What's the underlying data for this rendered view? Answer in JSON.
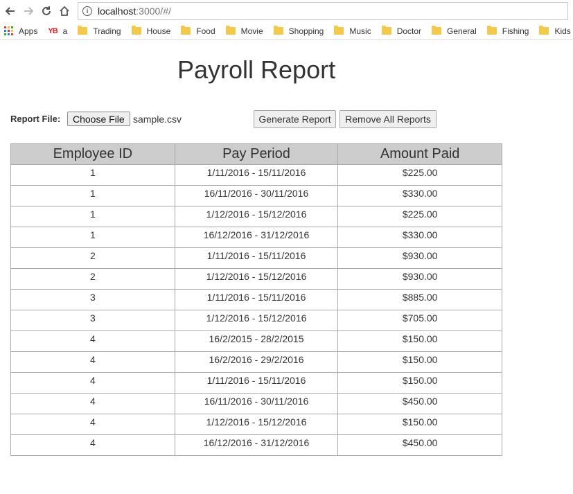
{
  "browser": {
    "url_host": "localhost",
    "url_path": ":3000/#/",
    "bookmarks": [
      {
        "label": "Apps",
        "icon": "apps-grid-icon"
      },
      {
        "label": "a",
        "icon": "yb-icon"
      },
      {
        "label": "Trading",
        "icon": "folder-icon"
      },
      {
        "label": "House",
        "icon": "folder-icon"
      },
      {
        "label": "Food",
        "icon": "folder-icon"
      },
      {
        "label": "Movie",
        "icon": "folder-icon"
      },
      {
        "label": "Shopping",
        "icon": "folder-icon"
      },
      {
        "label": "Music",
        "icon": "folder-icon"
      },
      {
        "label": "Doctor",
        "icon": "folder-icon"
      },
      {
        "label": "General",
        "icon": "folder-icon"
      },
      {
        "label": "Fishing",
        "icon": "folder-icon"
      },
      {
        "label": "Kids",
        "icon": "folder-icon"
      }
    ],
    "yb_text": "YB"
  },
  "page": {
    "title": "Payroll Report",
    "report_file_label": "Report File:",
    "choose_file_label": "Choose File",
    "file_name": "sample.csv",
    "generate_label": "Generate Report",
    "remove_label": "Remove All Reports"
  },
  "table": {
    "headers": [
      "Employee ID",
      "Pay Period",
      "Amount Paid"
    ],
    "rows": [
      [
        "1",
        "1/11/2016 - 15/11/2016",
        "$225.00"
      ],
      [
        "1",
        "16/11/2016 - 30/11/2016",
        "$330.00"
      ],
      [
        "1",
        "1/12/2016 - 15/12/2016",
        "$225.00"
      ],
      [
        "1",
        "16/12/2016 - 31/12/2016",
        "$330.00"
      ],
      [
        "2",
        "1/11/2016 - 15/11/2016",
        "$930.00"
      ],
      [
        "2",
        "1/12/2016 - 15/12/2016",
        "$930.00"
      ],
      [
        "3",
        "1/11/2016 - 15/11/2016",
        "$885.00"
      ],
      [
        "3",
        "1/12/2016 - 15/12/2016",
        "$705.00"
      ],
      [
        "4",
        "16/2/2015 - 28/2/2015",
        "$150.00"
      ],
      [
        "4",
        "16/2/2016 - 29/2/2016",
        "$150.00"
      ],
      [
        "4",
        "1/11/2016 - 15/11/2016",
        "$150.00"
      ],
      [
        "4",
        "16/11/2016 - 30/11/2016",
        "$450.00"
      ],
      [
        "4",
        "1/12/2016 - 15/12/2016",
        "$150.00"
      ],
      [
        "4",
        "16/12/2016 - 31/12/2016",
        "$450.00"
      ]
    ]
  },
  "colors": {
    "header_bg": "#cccccc",
    "folder": "#f2c94c"
  }
}
